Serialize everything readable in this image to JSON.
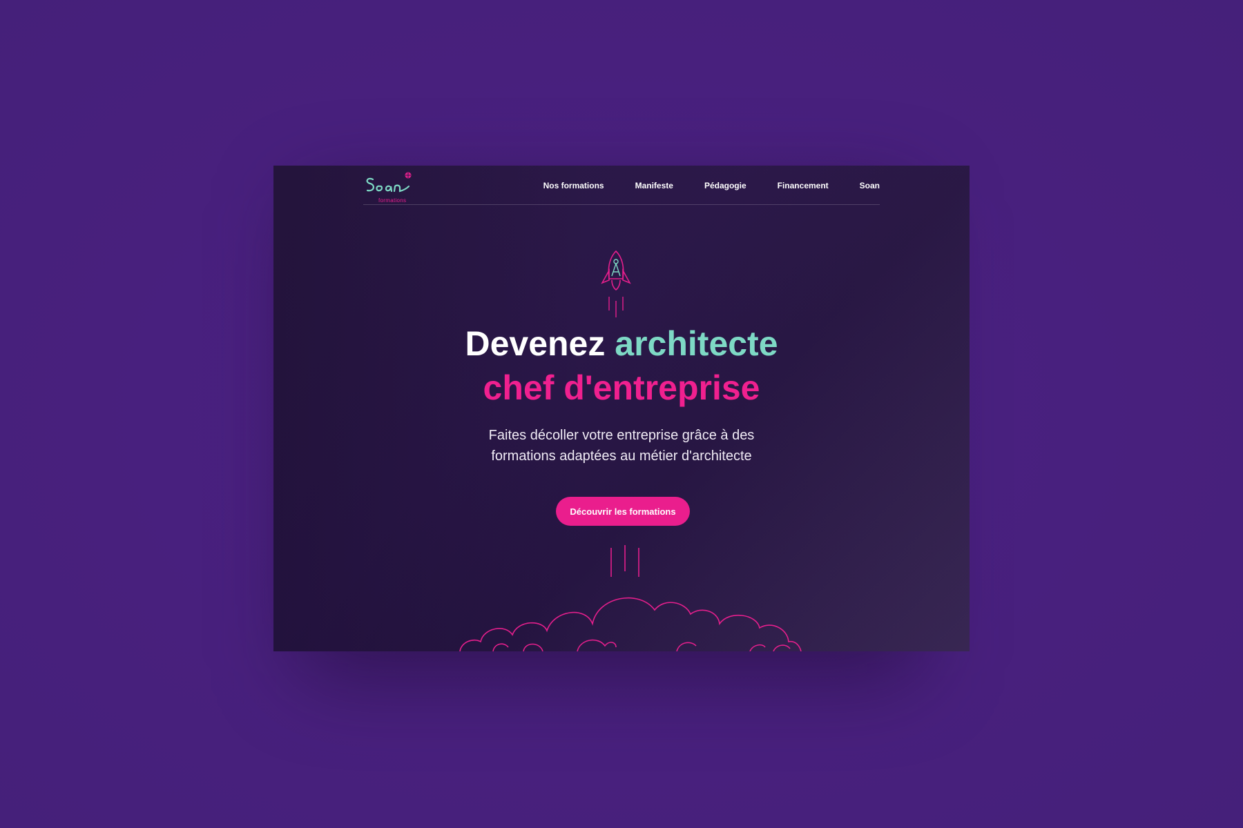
{
  "logo": {
    "text": "Soan",
    "sub": "formations"
  },
  "nav": {
    "items": [
      {
        "label": "Nos formations"
      },
      {
        "label": "Manifeste"
      },
      {
        "label": "Pédagogie"
      },
      {
        "label": "Financement"
      },
      {
        "label": "Soan"
      }
    ]
  },
  "hero": {
    "title_white": "Devenez",
    "title_teal": "architecte",
    "title_pink": "chef d'entreprise",
    "subtitle_line1": "Faites décoller votre entreprise grâce à des",
    "subtitle_line2": "formations adaptées au métier d'architecte",
    "cta_label": "Découvrir les formations"
  },
  "colors": {
    "page_background": "#4a2180",
    "card_background": "#2a1748",
    "accent_pink": "#ea1e8d",
    "accent_teal": "#7ed9c5"
  },
  "icons": [
    "rocket-compass-icon",
    "smoke-cloud-illustration",
    "soan-logo"
  ]
}
